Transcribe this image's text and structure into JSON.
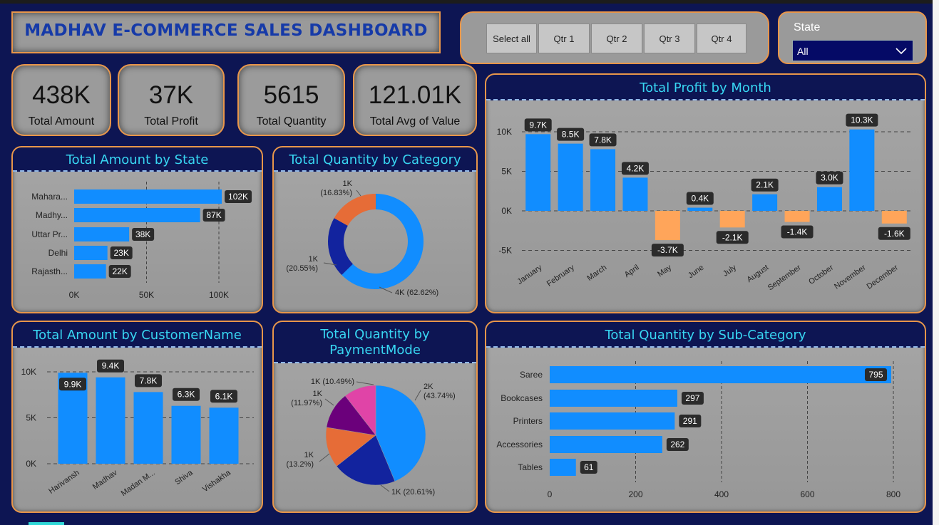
{
  "header": {
    "title": "MADHAV E-COMMERCE SALES DASHBOARD"
  },
  "quarter_slicer": {
    "buttons": [
      "Select all",
      "Qtr 1",
      "Qtr 2",
      "Qtr 3",
      "Qtr 4"
    ]
  },
  "state_filter": {
    "label": "State",
    "value": "All"
  },
  "kpis": [
    {
      "value": "438K",
      "label": "Total Amount"
    },
    {
      "value": "37K",
      "label": "Total Profit"
    },
    {
      "value": "5615",
      "label": "Total Quantity"
    },
    {
      "value": "121.01K",
      "label": "Total Avg of Value"
    }
  ],
  "colors": {
    "positive": "#118dff",
    "negative": "#ffa55a",
    "donut": [
      "#118dff",
      "#12239e",
      "#e66c37"
    ],
    "pie": [
      "#118dff",
      "#12239e",
      "#e66c37",
      "#6b007b",
      "#e044a7"
    ]
  },
  "chart_data": [
    {
      "id": "state",
      "type": "bar",
      "orientation": "horizontal",
      "title": "Total Amount by State",
      "categories": [
        "Mahara...",
        "Madhy...",
        "Uttar Pr...",
        "Delhi",
        "Rajasth..."
      ],
      "values": [
        102,
        87,
        38,
        23,
        22
      ],
      "labels": [
        "102K",
        "87K",
        "38K",
        "23K",
        "22K"
      ],
      "xticks": [
        "0K",
        "50K",
        "100K"
      ],
      "xlim": [
        0,
        100
      ]
    },
    {
      "id": "category",
      "type": "pie",
      "variant": "donut",
      "title": "Total Quantity by Category",
      "values": [
        62.62,
        20.55,
        16.83
      ],
      "labels": [
        "4K (62.62%)",
        [
          "1K",
          "(20.55%)"
        ],
        [
          "1K",
          "(16.83%)"
        ]
      ]
    },
    {
      "id": "month",
      "type": "bar",
      "title": "Total Profit by Month",
      "categories": [
        "January",
        "February",
        "March",
        "April",
        "May",
        "June",
        "July",
        "August",
        "September",
        "October",
        "November",
        "December"
      ],
      "values": [
        9.7,
        8.5,
        7.8,
        4.2,
        -3.7,
        0.4,
        -2.1,
        2.1,
        -1.4,
        3.0,
        10.3,
        -1.6
      ],
      "labels": [
        "9.7K",
        "8.5K",
        "7.8K",
        "4.2K",
        "-3.7K",
        "0.4K",
        "-2.1K",
        "2.1K",
        "-1.4K",
        "3.0K",
        "10.3K",
        "-1.6K"
      ],
      "yticks": [
        "10K",
        "5K",
        "0K",
        "-5K"
      ],
      "ylim": [
        -6,
        11
      ]
    },
    {
      "id": "customer",
      "type": "bar",
      "title": "Total Amount by CustomerName",
      "categories": [
        "Harivansh",
        "Madhav",
        "Madan M...",
        "Shiva",
        "Vishakha"
      ],
      "values": [
        9.9,
        9.4,
        7.8,
        6.3,
        6.1
      ],
      "labels": [
        "9.9K",
        "9.4K",
        "7.8K",
        "6.3K",
        "6.1K"
      ],
      "yticks": [
        "10K",
        "5K",
        "0K"
      ],
      "ylim": [
        0,
        10
      ]
    },
    {
      "id": "payment",
      "type": "pie",
      "title": "Total Quantity by PaymentMode",
      "values": [
        43.74,
        20.61,
        13.2,
        11.97,
        10.49
      ],
      "labels": [
        [
          "2K",
          "(43.74%)"
        ],
        "1K (20.61%)",
        [
          "1K",
          "(13.2%)"
        ],
        [
          "1K",
          "(11.97%)"
        ],
        "1K (10.49%)"
      ]
    },
    {
      "id": "subcat",
      "type": "bar",
      "orientation": "horizontal",
      "title": "Total Quantity by Sub-Category",
      "categories": [
        "Saree",
        "Bookcases",
        "Printers",
        "Accessories",
        "Tables"
      ],
      "values": [
        795,
        297,
        291,
        262,
        61
      ],
      "labels": [
        "795",
        "297",
        "291",
        "262",
        "61"
      ],
      "xticks": [
        "0",
        "200",
        "400",
        "600",
        "800"
      ],
      "xlim": [
        0,
        800
      ]
    }
  ]
}
